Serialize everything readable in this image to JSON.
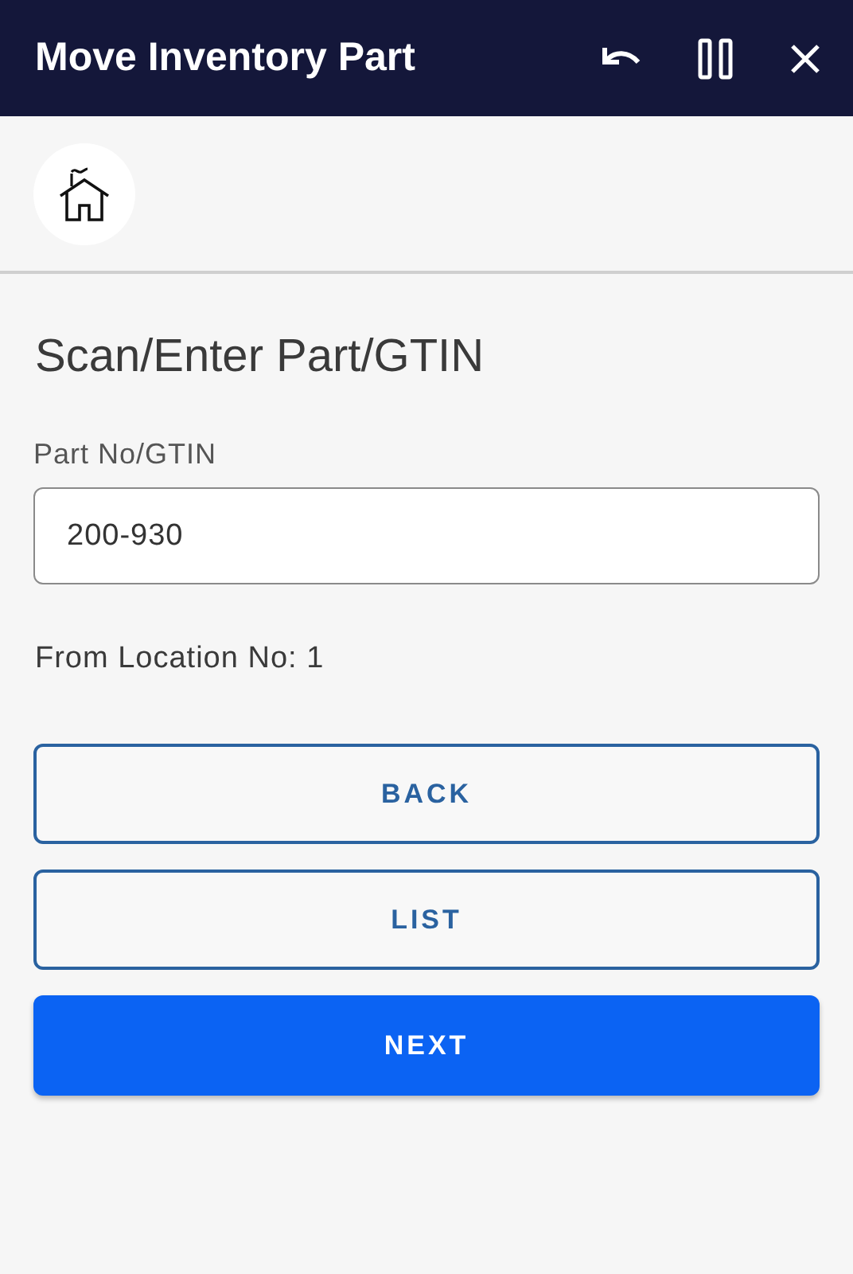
{
  "header": {
    "title": "Move Inventory Part"
  },
  "page": {
    "heading": "Scan/Enter Part/GTIN"
  },
  "field": {
    "label": "Part No/GTIN",
    "value": "200-930"
  },
  "info": "From Location No: 1",
  "buttons": [
    {
      "label": "BACK",
      "kind": "outlined"
    },
    {
      "label": "LIST",
      "kind": "outlined"
    },
    {
      "label": "NEXT",
      "kind": "primary"
    }
  ]
}
